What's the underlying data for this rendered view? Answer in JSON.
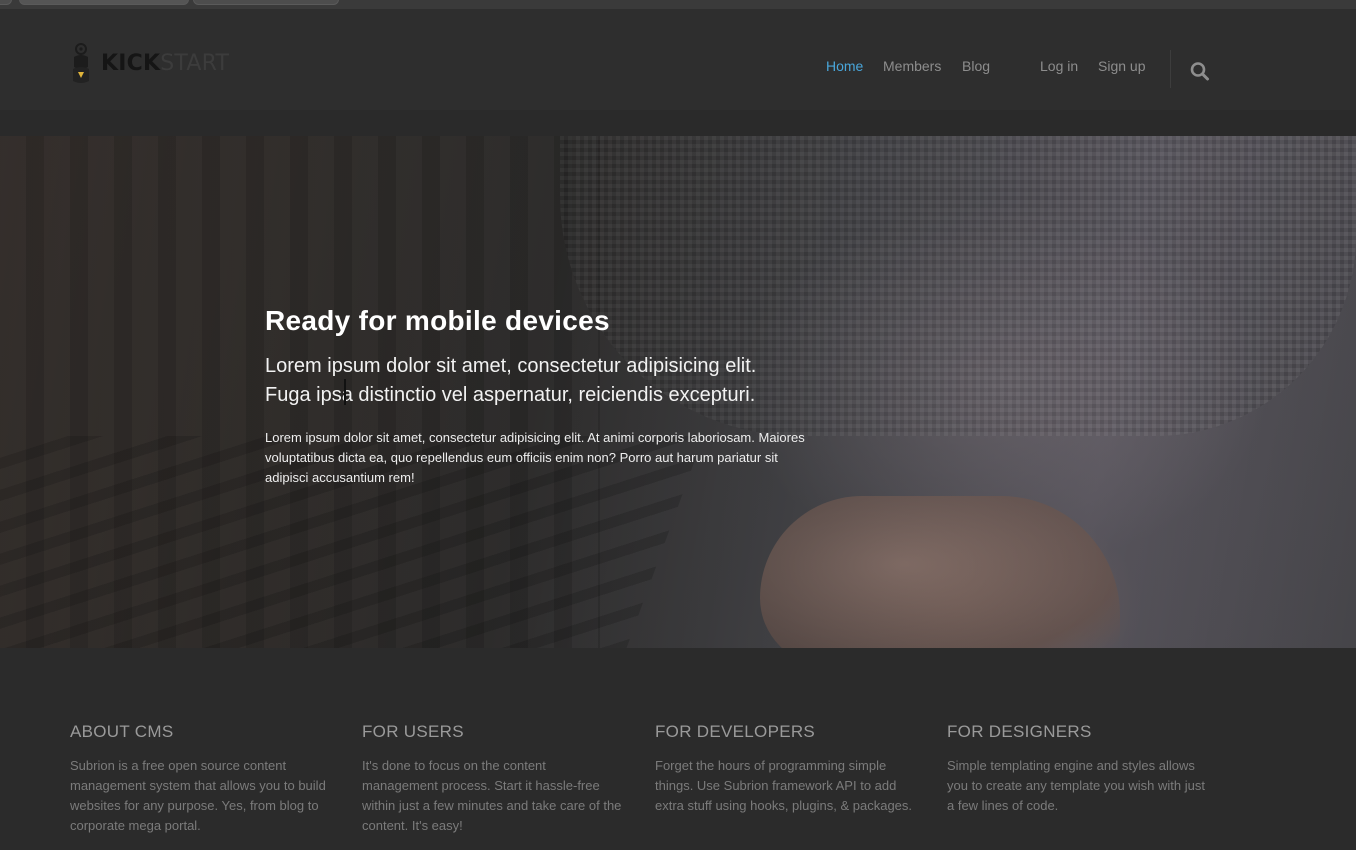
{
  "brand": {
    "logo_part1": "KICK",
    "logo_part2": "START"
  },
  "nav": {
    "items": [
      "Home",
      "Members",
      "Blog"
    ],
    "login": "Log in",
    "signup": "Sign up",
    "active_color": "#49a6da"
  },
  "hero": {
    "title": "Ready for mobile devices",
    "lead_line1": "Lorem ipsum dolor sit amet, consectetur adipisicing elit.",
    "lead_line2": "Fuga ipsa distinctio vel aspernatur, reiciendis excepturi.",
    "text": "Lorem ipsum dolor sit amet, consectetur adipisicing elit. At animi corporis laboriosam. Maiores voluptatibus dicta ea, quo repellendus eum officiis enim non? Porro aut harum pariatur sit adipisci accusantium rem!"
  },
  "features": [
    {
      "title": "ABOUT CMS",
      "text": "Subrion is a free open source content management system that allows you to build websites for any purpose. Yes, from blog to corporate mega portal."
    },
    {
      "title": "FOR USERS",
      "text": "It's done to focus on the content management process. Start it hassle-free within just a few minutes and take care of the content. It's easy!"
    },
    {
      "title": "FOR DEVELOPERS",
      "text": "Forget the hours of programming simple things. Use Subrion framework API to add extra stuff using hooks, plugins, & packages."
    },
    {
      "title": "FOR DESIGNERS",
      "text": "Simple templating engine and styles allows you to create any template you wish with just a few lines of code."
    }
  ],
  "icons": {
    "search": "search-icon",
    "logo": "kickstart-logo-icon"
  }
}
